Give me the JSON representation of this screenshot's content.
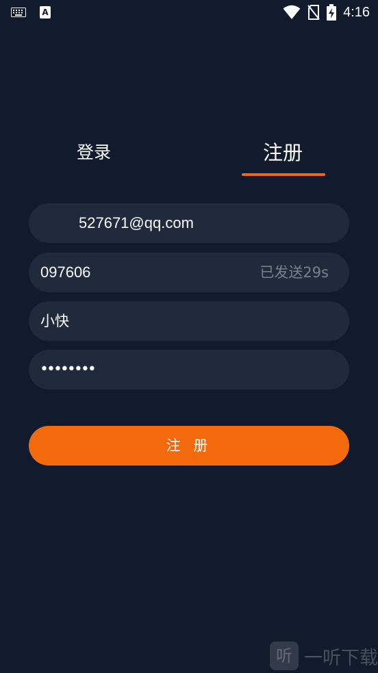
{
  "status_bar": {
    "time": "4:16",
    "left_icons": [
      "keyboard-icon",
      "a-icon"
    ],
    "a_icon_letter": "A",
    "right_icons": [
      "wifi-icon",
      "no-sim-icon",
      "battery-charging-icon"
    ]
  },
  "tabs": {
    "login_label": "登录",
    "register_label": "注册",
    "active": "register"
  },
  "form": {
    "email_value": "527671@qq.com",
    "code_value": "097606",
    "code_sent_label": "已发送29s",
    "nickname_value": "小快",
    "password_value": "••••••••"
  },
  "register_button_label": "注 册",
  "watermark": {
    "logo_char": "听",
    "text": "一听下载"
  },
  "colors": {
    "background": "#121a2d",
    "field_background": "#212a3d",
    "accent": "#f36a0d"
  }
}
